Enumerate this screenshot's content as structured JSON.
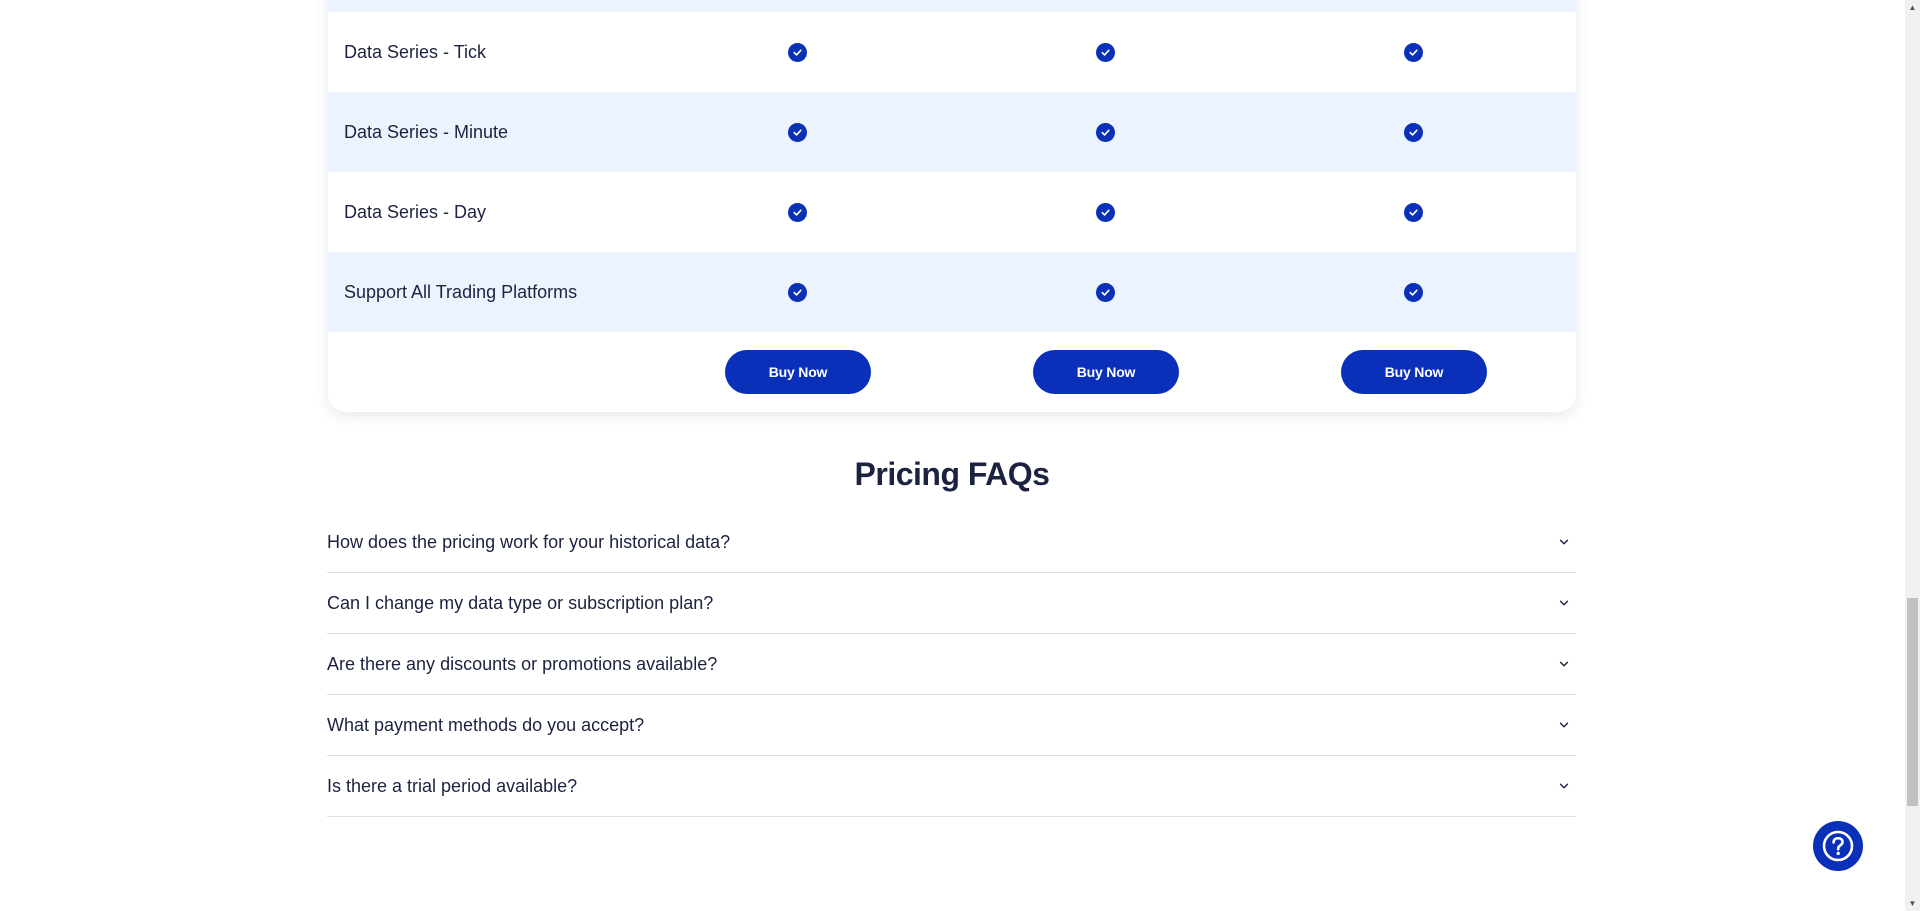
{
  "pricing_table": {
    "rows": [
      {
        "label": "Data Series - Tick",
        "plans": [
          true,
          true,
          true
        ]
      },
      {
        "label": "Data Series - Minute",
        "plans": [
          true,
          true,
          true
        ]
      },
      {
        "label": "Data Series - Day",
        "plans": [
          true,
          true,
          true
        ]
      },
      {
        "label": "Support All Trading Platforms",
        "plans": [
          true,
          true,
          true
        ]
      }
    ],
    "buy_buttons": [
      "Buy Now",
      "Buy Now",
      "Buy Now"
    ]
  },
  "faq": {
    "title": "Pricing FAQs",
    "items": [
      "How does the pricing work for your historical data?",
      "Can I change my data type or subscription plan?",
      "Are there any discounts or promotions available?",
      "What payment methods do you accept?",
      "Is there a trial period available?"
    ]
  },
  "icons": {
    "check": "check-circle-icon",
    "chevron": "chevron-down-icon",
    "help": "question-mark-icon"
  },
  "colors": {
    "accent": "#0a2fb9",
    "row_alt": "#ebf3fe",
    "text": "#1c2340"
  }
}
